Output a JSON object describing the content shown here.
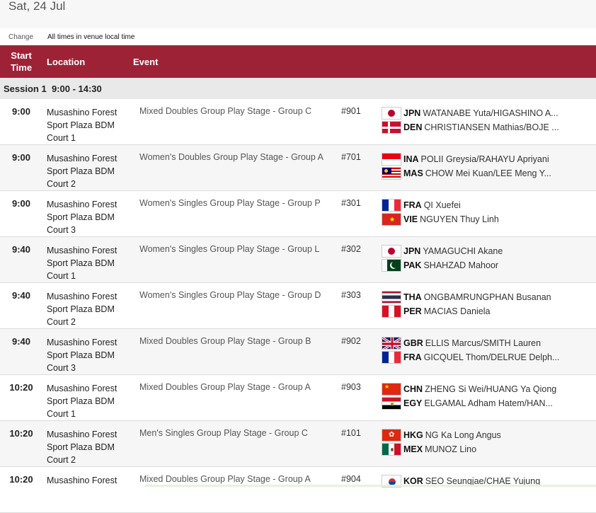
{
  "date": "Sat, 24 Jul",
  "timezone": {
    "change_label": "Change",
    "note": "All times in venue local time"
  },
  "header": {
    "start": "Start",
    "time": "Time",
    "location": "Location",
    "event": "Event"
  },
  "session": {
    "label": "Session 1",
    "time": "9:00 - 14:30"
  },
  "rows": [
    {
      "time": "9:00",
      "loc1": "Musashino Forest",
      "loc2": "Sport Plaza BDM",
      "loc3": "Court 1",
      "event": "Mixed Doubles Group Play Stage - Group C",
      "code": "#901",
      "t1": {
        "noc": "JPN",
        "name": "WATANABE Yuta/HIGASHINO A..."
      },
      "t2": {
        "noc": "DEN",
        "name": "CHRISTIANSEN Mathias/BOJE ..."
      }
    },
    {
      "time": "9:00",
      "loc1": "Musashino Forest",
      "loc2": "Sport Plaza BDM",
      "loc3": "Court 2",
      "event": "Women's Doubles Group Play Stage - Group A",
      "code": "#701",
      "t1": {
        "noc": "INA",
        "name": "POLII Greysia/RAHAYU Apriyani"
      },
      "t2": {
        "noc": "MAS",
        "name": "CHOW Mei Kuan/LEE Meng Y..."
      }
    },
    {
      "time": "9:00",
      "loc1": "Musashino Forest",
      "loc2": "Sport Plaza BDM",
      "loc3": "Court 3",
      "event": "Women's Singles Group Play Stage - Group P",
      "code": "#301",
      "t1": {
        "noc": "FRA",
        "name": "QI Xuefei"
      },
      "t2": {
        "noc": "VIE",
        "name": "NGUYEN Thuy Linh"
      }
    },
    {
      "time": "9:40",
      "loc1": "Musashino Forest",
      "loc2": "Sport Plaza BDM",
      "loc3": "Court 1",
      "event": "Women's Singles Group Play Stage - Group L",
      "code": "#302",
      "t1": {
        "noc": "JPN",
        "name": "YAMAGUCHI Akane"
      },
      "t2": {
        "noc": "PAK",
        "name": "SHAHZAD Mahoor"
      }
    },
    {
      "time": "9:40",
      "loc1": "Musashino Forest",
      "loc2": "Sport Plaza BDM",
      "loc3": "Court 2",
      "event": "Women's Singles Group Play Stage - Group D",
      "code": "#303",
      "t1": {
        "noc": "THA",
        "name": "ONGBAMRUNGPHAN Busanan"
      },
      "t2": {
        "noc": "PER",
        "name": "MACIAS Daniela"
      }
    },
    {
      "time": "9:40",
      "loc1": "Musashino Forest",
      "loc2": "Sport Plaza BDM",
      "loc3": "Court 3",
      "event": "Mixed Doubles Group Play Stage - Group B",
      "code": "#902",
      "t1": {
        "noc": "GBR",
        "name": "ELLIS Marcus/SMITH Lauren"
      },
      "t2": {
        "noc": "FRA",
        "name": "GICQUEL Thom/DELRUE Delph..."
      }
    },
    {
      "time": "10:20",
      "loc1": "Musashino Forest",
      "loc2": "Sport Plaza BDM",
      "loc3": "Court 1",
      "event": "Mixed Doubles Group Play Stage - Group A",
      "code": "#903",
      "t1": {
        "noc": "CHN",
        "name": "ZHENG Si Wei/HUANG Ya Qiong"
      },
      "t2": {
        "noc": "EGY",
        "name": "ELGAMAL Adham Hatem/HAN..."
      }
    },
    {
      "time": "10:20",
      "loc1": "Musashino Forest",
      "loc2": "Sport Plaza BDM",
      "loc3": "Court 2",
      "event": "Men's Singles Group Play Stage - Group C",
      "code": "#101",
      "t1": {
        "noc": "HKG",
        "name": "NG Ka Long Angus"
      },
      "t2": {
        "noc": "MEX",
        "name": "MUNOZ Lino"
      }
    },
    {
      "time": "10:20",
      "loc1": "Musashino Forest",
      "loc2": "",
      "loc3": "",
      "event": "Mixed Doubles Group Play Stage - Group A",
      "code": "#904",
      "t1": {
        "noc": "KOR",
        "name": "SEO Seungjae/CHAE Yujung"
      },
      "t2": {
        "noc": "",
        "name": ""
      }
    }
  ]
}
